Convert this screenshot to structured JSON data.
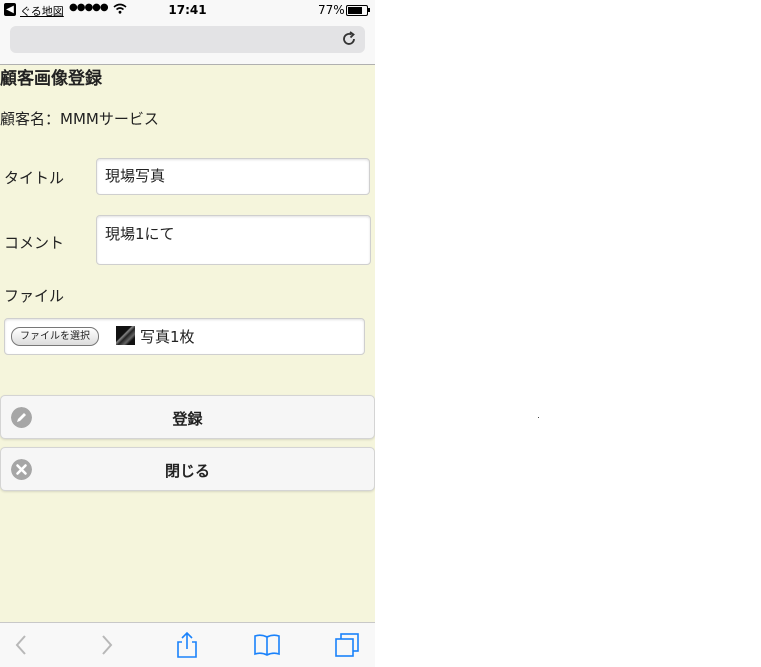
{
  "status_bar": {
    "back_app": "ぐる地図",
    "signal": "●●●●●",
    "time": "17:41",
    "battery_text": "77%",
    "battery_level": 0.77
  },
  "page": {
    "title": "顧客画像登録",
    "customer_label": "顧客名：MMMサービス"
  },
  "form": {
    "title_label": "タイトル",
    "title_value": "現場写真",
    "comment_label": "コメント",
    "comment_value": "現場1にて",
    "file_label": "ファイル",
    "file_button": "ファイルを選択",
    "file_name": "写真1枚"
  },
  "buttons": {
    "register": "登録",
    "close": "閉じる"
  },
  "icons": {
    "reload": "reload-icon",
    "pencil": "pencil-icon",
    "close": "close-icon",
    "back": "back-arrow-icon",
    "forward": "forward-arrow-icon",
    "share": "share-icon",
    "bookmarks": "bookmarks-icon",
    "tabs": "tabs-icon"
  },
  "colors": {
    "page_background": "#f5f5dc",
    "toolbar_accent": "#1a82fb",
    "toolbar_disabled": "#b8b8b8"
  }
}
